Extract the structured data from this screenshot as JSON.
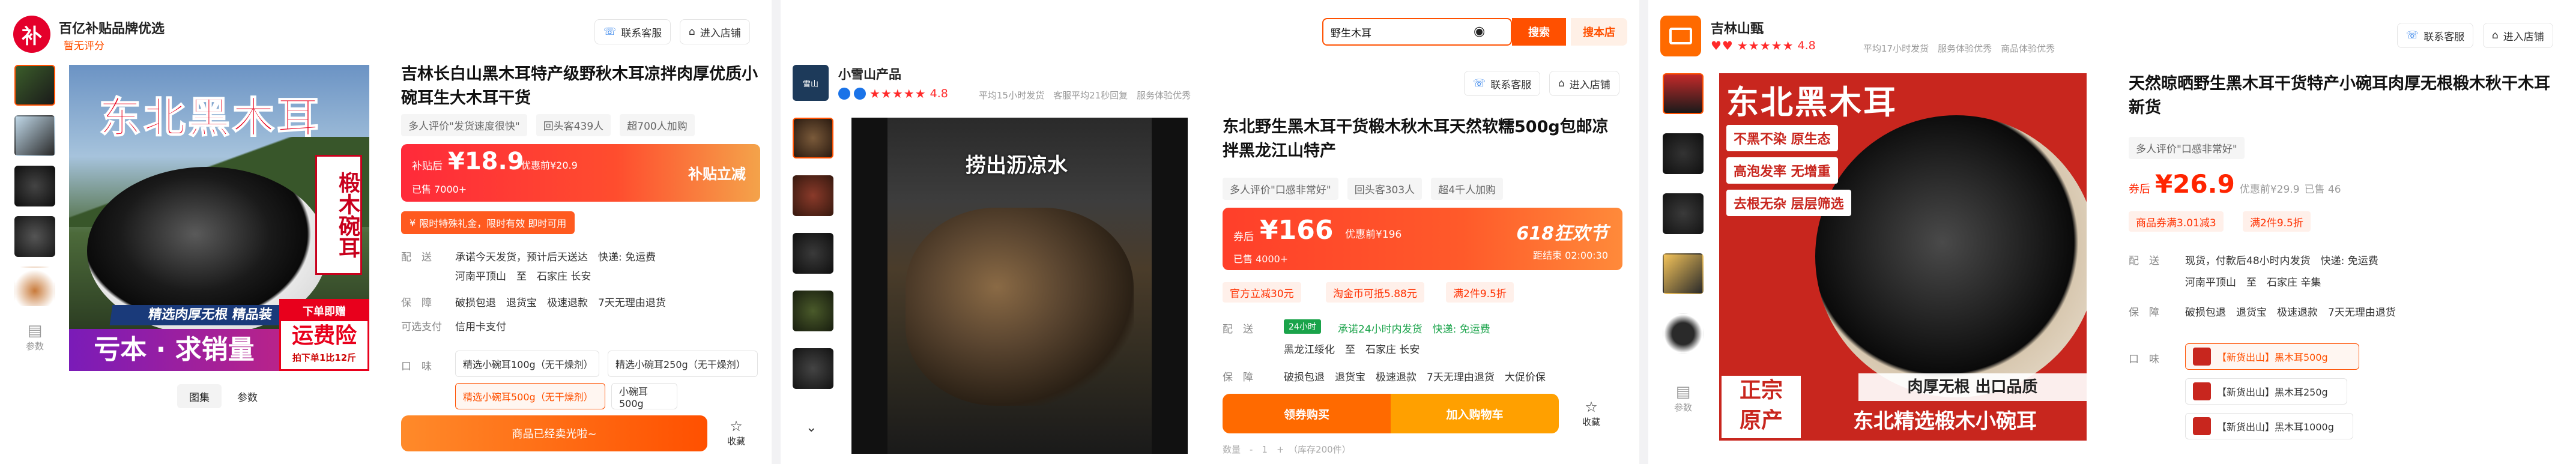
{
  "p1": {
    "shop_name": "百亿补贴品牌优选",
    "shop_rating": "暂无评分",
    "logo_char": "补",
    "thumb_label": "参数",
    "hero_text": "东北黑木耳",
    "hero_vtext": "椴木碗耳",
    "hero_band": "精选肉厚无根 精品装",
    "hero_slogan": "亏本 · 求销量",
    "hero_promo1": "下单即赠",
    "hero_promo2": "运费险",
    "hero_promo3": "拍下单1比12斤",
    "gallery_tabs": [
      "图集",
      "参数"
    ],
    "service_btn": "联系客服",
    "store_btn": "进入店铺",
    "title": "吉林长白山黑木耳特产级野秋木耳凉拌肉厚优质小碗耳生大木耳干货",
    "tags": [
      "多人评价\"发货速度很快\"",
      "回头客439人",
      "超700人加购"
    ],
    "price_prefix": "补贴后",
    "price": "¥18.9",
    "price_orig": "优惠前¥20.9",
    "sold": "已售 7000+",
    "subsidy_label": "补贴立减",
    "limit_note": "限时特殊礼金，限时有效 即时可用",
    "ship_label": "配　送",
    "ship_line1": "承诺今天发货，预计后天送达　快递: 免运费",
    "ship_line2": "河南平顶山　至　石家庄 长安",
    "guarantee_label": "保　障",
    "guarantee": "破损包退　退货宝　极速退款　7天无理由退货",
    "pay_label": "可选支付",
    "pay_value": "信用卡支付",
    "spec_label": "口　味",
    "specs": [
      "精选小碗耳100g（无干燥剂）",
      "精选小碗耳250g（无干燥剂）",
      "精选小碗耳500g（无干燥剂）",
      "小碗耳500g"
    ],
    "buy_btn": "商品已经卖光啦~",
    "fav_label": "收藏"
  },
  "p2": {
    "shop_name": "小雪山产品",
    "rating": "4.8",
    "shop_meta": "平均15小时发货　客服平均21秒回复　服务体验优秀",
    "thumb_logo": "小雪山产品",
    "video_caption": "捞出沥凉水",
    "search_value": "野生木耳",
    "search_btn": "搜索",
    "store_search_btn": "搜本店",
    "service_btn": "联系客服",
    "store_btn": "进入店铺",
    "title": "东北野生黑木耳干货椴木秋木耳天然软糯500g包邮凉拌黑龙江山特产",
    "tags": [
      "多人评价\"口感非常好\"",
      "回头客303人",
      "超4千人加购"
    ],
    "price_prefix": "券后",
    "price": "¥166",
    "price_orig": "优惠前¥196",
    "sold": "已售 4000+",
    "festival": "618狂欢节",
    "countdown": "距结束 02:00:30",
    "coupons": [
      "官方立减30元",
      "淘金币可抵5.88元",
      "满2件9.5折"
    ],
    "ship_label": "配　送",
    "ship_tag": "24小时",
    "ship_line1": "承诺24小时内发货　快递: 免运费",
    "ship_line2": "黑龙江绥化　至　石家庄 长安",
    "guarantee_label": "保　障",
    "guarantee": "破损包退　退货宝　极速退款　7天无理由退货　大促价保",
    "buy_now": "领券购买",
    "add_cart": "加入购物车",
    "fav_label": "收藏",
    "qty_line": "数量　-　1　+　（库存200件）"
  },
  "p3": {
    "shop_name": "吉林山甄",
    "rating": "4.8",
    "shop_meta": "平均17小时发货　服务体验优秀　商品体验优秀",
    "thumb_label": "参数",
    "service_btn": "联系客服",
    "store_btn": "进入店铺",
    "hero_title": "东北黑木耳",
    "hero_points": [
      "不黑不染 原生态",
      "高泡发率 无增重",
      "去根无杂 层层筛选"
    ],
    "hero_banner": "肉厚无根 出口品质",
    "hero_stamp1": "正宗",
    "hero_stamp2": "原产",
    "hero_footer": "东北精选椴木小碗耳",
    "title": "天然晾晒野生黑木耳干货特产小碗耳肉厚无根椴木秋干木耳新货",
    "tags": [
      "多人评价\"口感非常好\""
    ],
    "price_prefix": "券后",
    "price": "¥26.9",
    "price_orig": "优惠前¥29.9",
    "sold": "已售 46",
    "coupons": [
      "商品券满3.01减3",
      "满2件9.5折"
    ],
    "ship_label": "配　送",
    "ship_line1": "现货，付款后48小时内发货　快递: 免运费",
    "ship_line2": "河南平顶山　至　石家庄 辛集",
    "guarantee_label": "保　障",
    "guarantee": "破损包退　退货宝　极速退款　7天无理由退货",
    "spec_label": "口　味",
    "specs": [
      "【新货出山】黑木耳500g",
      "【新货出山】黑木耳250g",
      "【新货出山】黑木耳1000g"
    ]
  },
  "colors": {
    "accent": "#ff5000",
    "price_red": "#ff2400",
    "tmall_red": "#ff0036"
  }
}
